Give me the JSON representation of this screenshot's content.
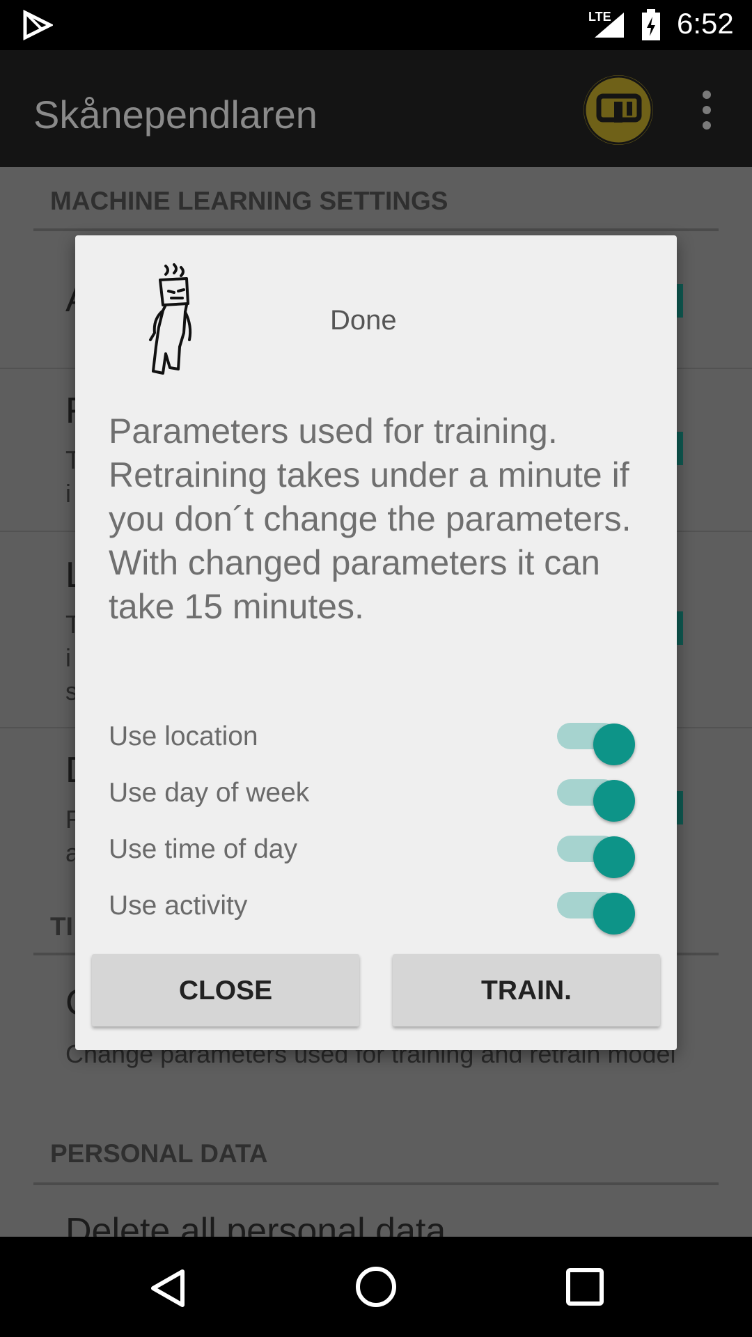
{
  "status_bar": {
    "network": "LTE",
    "time": "6:52"
  },
  "app_bar": {
    "title": "Skånependlaren"
  },
  "background": {
    "section_ml": "MACHINE LEARNING SETTINGS",
    "row1_title_fragment": "A",
    "row2_title_fragment": "F",
    "row2_sub1": "T",
    "row2_sub2": "i",
    "row3_title_fragment": "L",
    "row3_sub1": "T",
    "row3_sub2": "i",
    "row3_sub3": "s",
    "row4_title_fragment": "D",
    "row4_sub1": "F",
    "row4_sub2": "a",
    "section_tr_fragment": "TI",
    "row5_title_fragment": "C",
    "row5_subtitle": "Change parameters used for training and retrain model",
    "section_personal": "PERSONAL DATA",
    "delete_all": "Delete all personal data"
  },
  "dialog": {
    "status": "Done",
    "message": "Parameters used for training. Retraining takes under a minute if you don´t change the parameters. With changed parameters it can take 15 minutes.",
    "toggles": [
      {
        "label": "Use location",
        "on": true
      },
      {
        "label": "Use day of week",
        "on": true
      },
      {
        "label": "Use time of day",
        "on": true
      },
      {
        "label": "Use activity",
        "on": true
      }
    ],
    "close_label": "CLOSE",
    "train_label": "TRAIN."
  },
  "colors": {
    "accent": "#0d9488",
    "track": "#a6d3cf"
  },
  "icons": [
    "play-store-icon",
    "signal-icon",
    "battery-charging-icon",
    "app-logo-icon",
    "overflow-menu-icon",
    "robot-illustration",
    "nav-back-icon",
    "nav-home-icon",
    "nav-recents-icon"
  ]
}
